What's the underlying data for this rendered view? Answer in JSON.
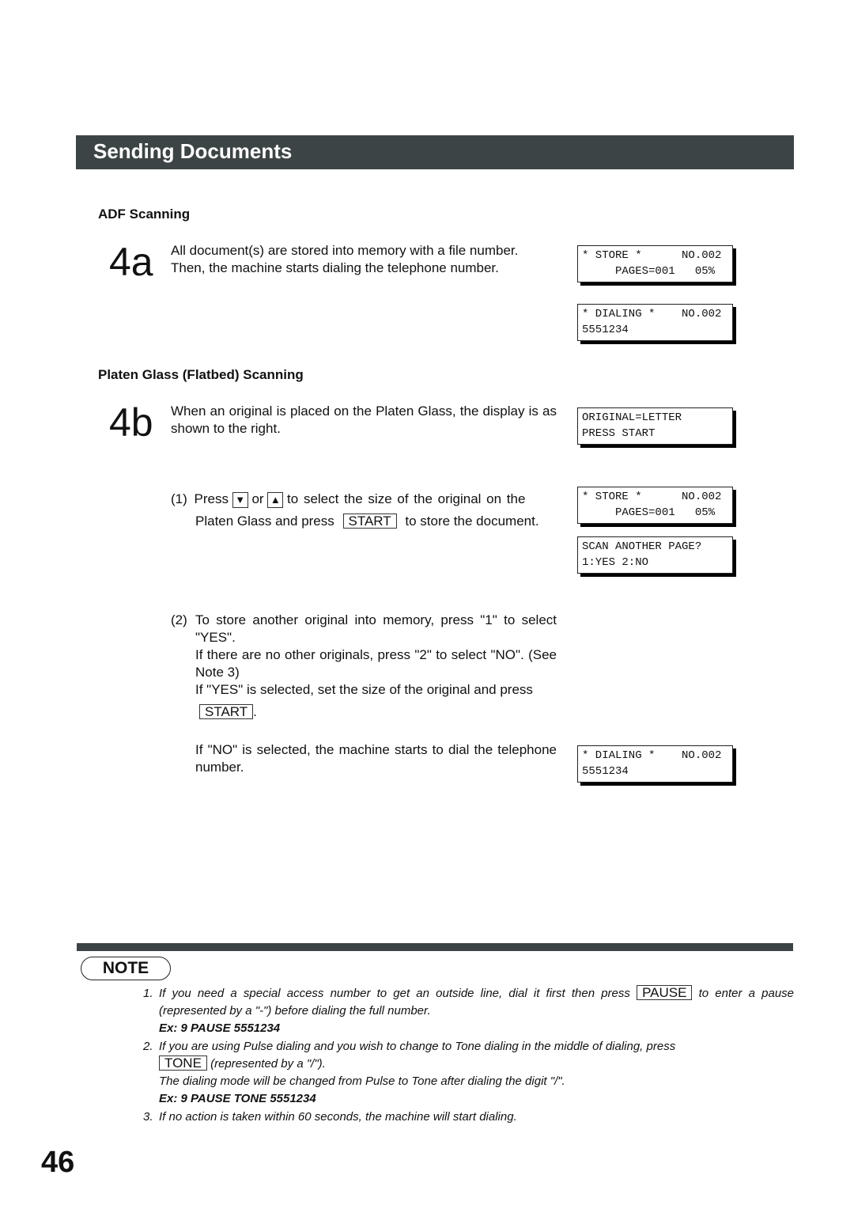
{
  "header": {
    "title": "Sending Documents"
  },
  "adf": {
    "heading": "ADF Scanning",
    "step": "4a",
    "text": "All document(s) are stored into memory with a file number. Then, the machine starts dialing the telephone number.",
    "lcd1": {
      "line1": "* STORE *      NO.002",
      "line2": "     PAGES=001   05%"
    },
    "lcd2": {
      "line1": "* DIALING *    NO.002",
      "line2": "5551234"
    }
  },
  "platen": {
    "heading": "Platen Glass (Flatbed) Scanning",
    "step": "4b",
    "text": "When an original is placed on the Platen Glass, the display is as shown to the right.",
    "lcd3": {
      "line1": "ORIGINAL=LETTER",
      "line2": "PRESS START"
    },
    "sub1": {
      "num": "(1)",
      "press": "Press",
      "or": "or",
      "after_arrows": "to select the size of the original on the",
      "line2a": "Platen Glass and press",
      "start_key": "START",
      "line2b": "to store the document.",
      "down_icon": "down-arrow-key",
      "up_icon": "up-arrow-key"
    },
    "lcd4": {
      "line1": "* STORE *      NO.002",
      "line2": "     PAGES=001   05%"
    },
    "lcd5": {
      "line1": "SCAN ANOTHER PAGE?",
      "line2": "1:YES 2:NO"
    },
    "sub2": {
      "num": "(2)",
      "p1": "To store another original into memory, press \"1\" to select \"YES\".",
      "p2": "If there are no other originals, press  \"2\" to select \"NO\". (See Note 3)",
      "p3": "If \"YES\" is selected, set the size of the original and press",
      "start_key": "START",
      "p3_end": ".",
      "p4": "If \"NO\" is selected, the machine starts to dial the telephone number."
    },
    "lcd6": {
      "line1": "* DIALING *    NO.002",
      "line2": "5551234"
    }
  },
  "notes": {
    "label": "NOTE",
    "items": [
      {
        "num": "1.",
        "a": "If you need a special access number to get an outside line, dial it first then press",
        "key": "PAUSE",
        "b": "to enter a pause (represented by a \"-\") before dialing the full number.",
        "ex": "Ex: 9 PAUSE 5551234"
      },
      {
        "num": "2.",
        "a": "If you are using Pulse dialing and you wish to change to Tone dialing in the middle of dialing, press",
        "key": "TONE",
        "b": "(represented by a \"/\").",
        "c": "The dialing mode will be changed from Pulse to Tone after dialing the digit \"/\".",
        "ex": "Ex: 9 PAUSE TONE 5551234"
      },
      {
        "num": "3.",
        "a": "If no action is taken within 60 seconds, the machine will start dialing."
      }
    ]
  },
  "page_number": "46"
}
